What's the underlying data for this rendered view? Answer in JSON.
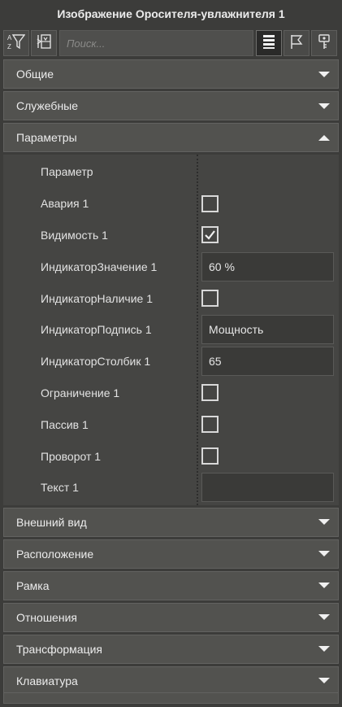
{
  "window": {
    "title": "Изображение Оросителя-увлажнителя 1"
  },
  "toolbar": {
    "filter_icon": "sort-filter-icon",
    "expand_icon": "expand-collapse-icon",
    "search_placeholder": "Поиск...",
    "list_icon": "list-icon",
    "flag_icon": "flag-icon",
    "key_icon": "key-icon"
  },
  "sections_top": [
    {
      "label": "Общие",
      "expanded": false
    },
    {
      "label": "Служебные",
      "expanded": false
    },
    {
      "label": "Параметры",
      "expanded": true
    }
  ],
  "params": {
    "header_label": "Параметр",
    "rows": [
      {
        "name": "Авария 1",
        "type": "checkbox",
        "checked": false
      },
      {
        "name": "Видимость 1",
        "type": "checkbox",
        "checked": true
      },
      {
        "name": "ИндикаторЗначение 1",
        "type": "text",
        "value": "60 %"
      },
      {
        "name": "ИндикаторНаличие 1",
        "type": "checkbox",
        "checked": false
      },
      {
        "name": "ИндикаторПодпись 1",
        "type": "text",
        "value": "Мощность"
      },
      {
        "name": "ИндикаторСтолбик 1",
        "type": "text",
        "value": "65"
      },
      {
        "name": "Ограничение 1",
        "type": "checkbox",
        "checked": false
      },
      {
        "name": "Пассив 1",
        "type": "checkbox",
        "checked": false
      },
      {
        "name": "Проворот 1",
        "type": "checkbox",
        "checked": false
      },
      {
        "name": "Текст 1",
        "type": "text",
        "value": ""
      }
    ]
  },
  "sections_bottom": [
    {
      "label": "Внешний вид",
      "expanded": false
    },
    {
      "label": "Расположение",
      "expanded": false
    },
    {
      "label": "Рамка",
      "expanded": false
    },
    {
      "label": "Отношения",
      "expanded": false
    },
    {
      "label": "Трансформация",
      "expanded": false
    },
    {
      "label": "Клавиатура",
      "expanded": false
    }
  ]
}
